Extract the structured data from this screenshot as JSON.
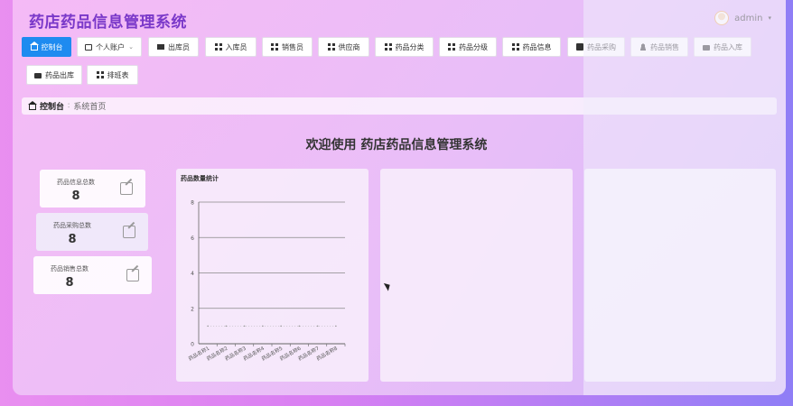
{
  "app": {
    "title": "药店药品信息管理系统"
  },
  "user": {
    "name": "admin",
    "caret": "▾"
  },
  "nav": [
    {
      "label": "控制台",
      "icon": "home-icon",
      "active": true
    },
    {
      "label": "个人账户",
      "icon": "card-icon",
      "dropdown": "⌄"
    },
    {
      "label": "出库员",
      "icon": "monitor-icon"
    },
    {
      "label": "入库员",
      "icon": "grid-icon"
    },
    {
      "label": "销售员",
      "icon": "grid-icon"
    },
    {
      "label": "供应商",
      "icon": "grid-icon"
    },
    {
      "label": "药品分类",
      "icon": "grid-icon"
    },
    {
      "label": "药品分级",
      "icon": "grid-icon"
    },
    {
      "label": "药品信息",
      "icon": "grid-icon"
    },
    {
      "label": "药品采购",
      "icon": "check-icon"
    },
    {
      "label": "药品销售",
      "icon": "user-icon"
    },
    {
      "label": "药品入库",
      "icon": "bag-icon"
    },
    {
      "label": "药品出库",
      "icon": "bag-icon"
    },
    {
      "label": "排班表",
      "icon": "grid-icon"
    }
  ],
  "breadcrumb": {
    "home": "控制台",
    "separator": "∶",
    "current": "系统首页"
  },
  "welcome": "欢迎使用 药店药品信息管理系统",
  "stats": [
    {
      "label": "药品信息总数",
      "value": "8"
    },
    {
      "label": "药品采购总数",
      "value": "8"
    },
    {
      "label": "药品销售总数",
      "value": "8"
    }
  ],
  "chart_data": {
    "type": "line",
    "title": "药品数量统计",
    "categories": [
      "药品名称1",
      "药品名称2",
      "药品名称3",
      "药品名称4",
      "药品名称5",
      "药品名称6",
      "药品名称7",
      "药品名称8"
    ],
    "values": [
      1,
      1,
      1,
      1,
      1,
      1,
      1,
      1
    ],
    "ylim": [
      0,
      8
    ],
    "yticks": [
      0,
      2,
      4,
      6,
      8
    ],
    "grid": true,
    "xlabel": "",
    "ylabel": ""
  },
  "colors": {
    "accent": "#1e8bf0",
    "title": "#7a38c9"
  }
}
